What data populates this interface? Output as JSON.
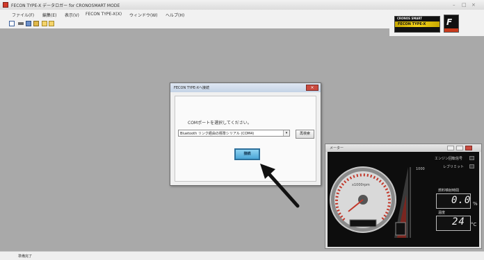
{
  "window": {
    "title": "FECON TYPE-X データロガー for CRONOSMART MODE",
    "min_glyph": "–",
    "max_glyph": "□",
    "close_glyph": "×"
  },
  "menu": [
    {
      "label": "ファイル(F)"
    },
    {
      "label": "編集(E)"
    },
    {
      "label": "表示(V)"
    },
    {
      "label": "FECON TYPE-X(X)"
    },
    {
      "label": "ウィンドウ(W)"
    },
    {
      "label": "ヘルプ(H)"
    }
  ],
  "banner": {
    "line1": "CRONOS SMART",
    "line2": "FECON TYPE-X"
  },
  "logo": {
    "text": "F"
  },
  "dialog": {
    "title": "FECON TYPE-Xへ接続",
    "close_glyph": "×",
    "prompt": "COMポートを選択してください。",
    "port_value": "Bluetooth リンク経由の標準シリアル (COM4)",
    "dropdown_arrow": "▾",
    "refresh_label": "再検索",
    "connect_label": "接続"
  },
  "gauge_window": {
    "title": "メーター",
    "indicators": [
      {
        "label": "エンジン回転信号"
      },
      {
        "label": "レブリミット"
      }
    ],
    "readouts": [
      {
        "label": "燃料噴射時間",
        "value": "0.0",
        "unit": "%"
      },
      {
        "label": "温度",
        "value": "24",
        "unit": "°C"
      }
    ],
    "tacho_label": "x1000rpm",
    "bar_scale": "1000"
  },
  "status": {
    "text": "準備完了"
  },
  "colors": {
    "workspace": "#a9a9a9",
    "connect_button": "#4aa5d6",
    "close_button": "#c94a3f",
    "gauge_bg": "#0d0d0d",
    "arrow": "#111111"
  }
}
